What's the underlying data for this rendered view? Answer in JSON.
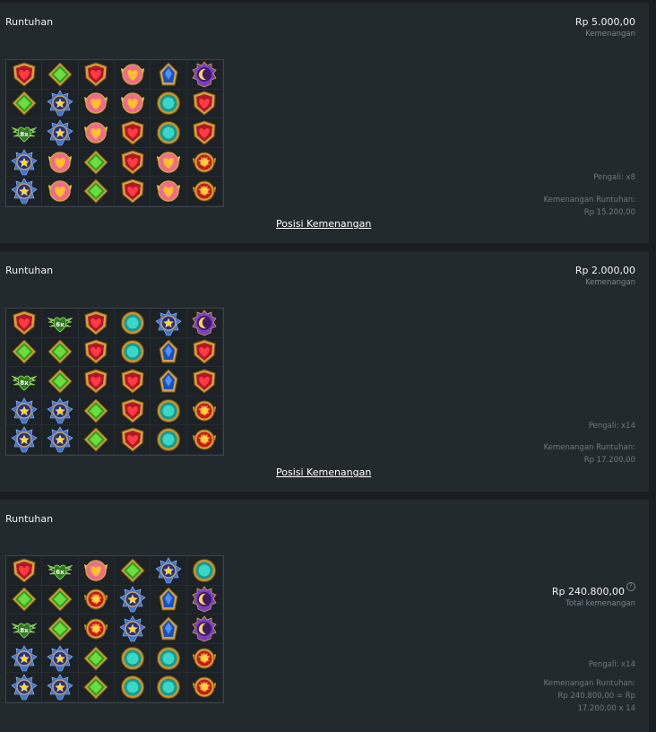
{
  "cards": [
    {
      "title": "Runtuhan",
      "amount": "Rp 5.000,00",
      "amount_label": "Kemenangan",
      "multiplier": "Pengali: x8",
      "cascade_label": "Kemenangan Runtuhan:",
      "cascade_value": "Rp 15.200,00",
      "link": "Posisi Kemenangan",
      "grid": [
        [
          "heart",
          "gem-green",
          "heart",
          "heart-wing",
          "gem-blue",
          "moon"
        ],
        [
          "gem-green",
          "star",
          "heart-wing",
          "heart-wing",
          "gem-teal",
          "heart"
        ],
        [
          "wing-8x",
          "star",
          "heart-wing",
          "heart",
          "gem-teal",
          "heart"
        ],
        [
          "star",
          "heart-wing",
          "gem-green",
          "heart",
          "heart-wing",
          "sun"
        ],
        [
          "star",
          "heart-wing",
          "gem-green",
          "heart",
          "heart-wing",
          "sun"
        ]
      ]
    },
    {
      "title": "Runtuhan",
      "amount": "Rp 2.000,00",
      "amount_label": "Kemenangan",
      "multiplier": "Pengali: x14",
      "cascade_label": "Kemenangan Runtuhan:",
      "cascade_value": "Rp 17.200,00",
      "link": "Posisi Kemenangan",
      "grid": [
        [
          "heart",
          "wing-6x",
          "heart",
          "gem-teal",
          "star",
          "moon"
        ],
        [
          "gem-green",
          "gem-green",
          "heart",
          "gem-teal",
          "gem-blue",
          "heart"
        ],
        [
          "wing-8x",
          "gem-green",
          "heart",
          "heart",
          "gem-blue",
          "heart"
        ],
        [
          "star",
          "star",
          "gem-green",
          "heart",
          "gem-teal",
          "sun"
        ],
        [
          "star",
          "star",
          "gem-green",
          "heart",
          "gem-teal",
          "sun"
        ]
      ]
    },
    {
      "title": "Runtuhan",
      "amount": "Rp 240.800,00",
      "amount_label": "Total kemenangan",
      "help_icon": "?",
      "multiplier": "Pengali: x14",
      "cascade_label": "Kemenangan Runtuhan:",
      "cascade_value": "Rp 240.800,00 = Rp",
      "cascade_value2": "17.200,00 x 14",
      "grid": [
        [
          "heart",
          "wing-6x",
          "heart-wing",
          "gem-green",
          "star",
          "gem-teal"
        ],
        [
          "gem-green",
          "gem-green",
          "sun",
          "star",
          "gem-blue",
          "moon"
        ],
        [
          "wing-8x",
          "gem-green",
          "sun",
          "star",
          "gem-blue",
          "moon"
        ],
        [
          "star",
          "star",
          "gem-green",
          "gem-teal",
          "gem-teal",
          "sun"
        ],
        [
          "star",
          "star",
          "gem-green",
          "gem-teal",
          "gem-teal",
          "sun"
        ]
      ]
    }
  ],
  "symbol_labels": {
    "wing-8x": "8x",
    "wing-6x": "6x"
  }
}
